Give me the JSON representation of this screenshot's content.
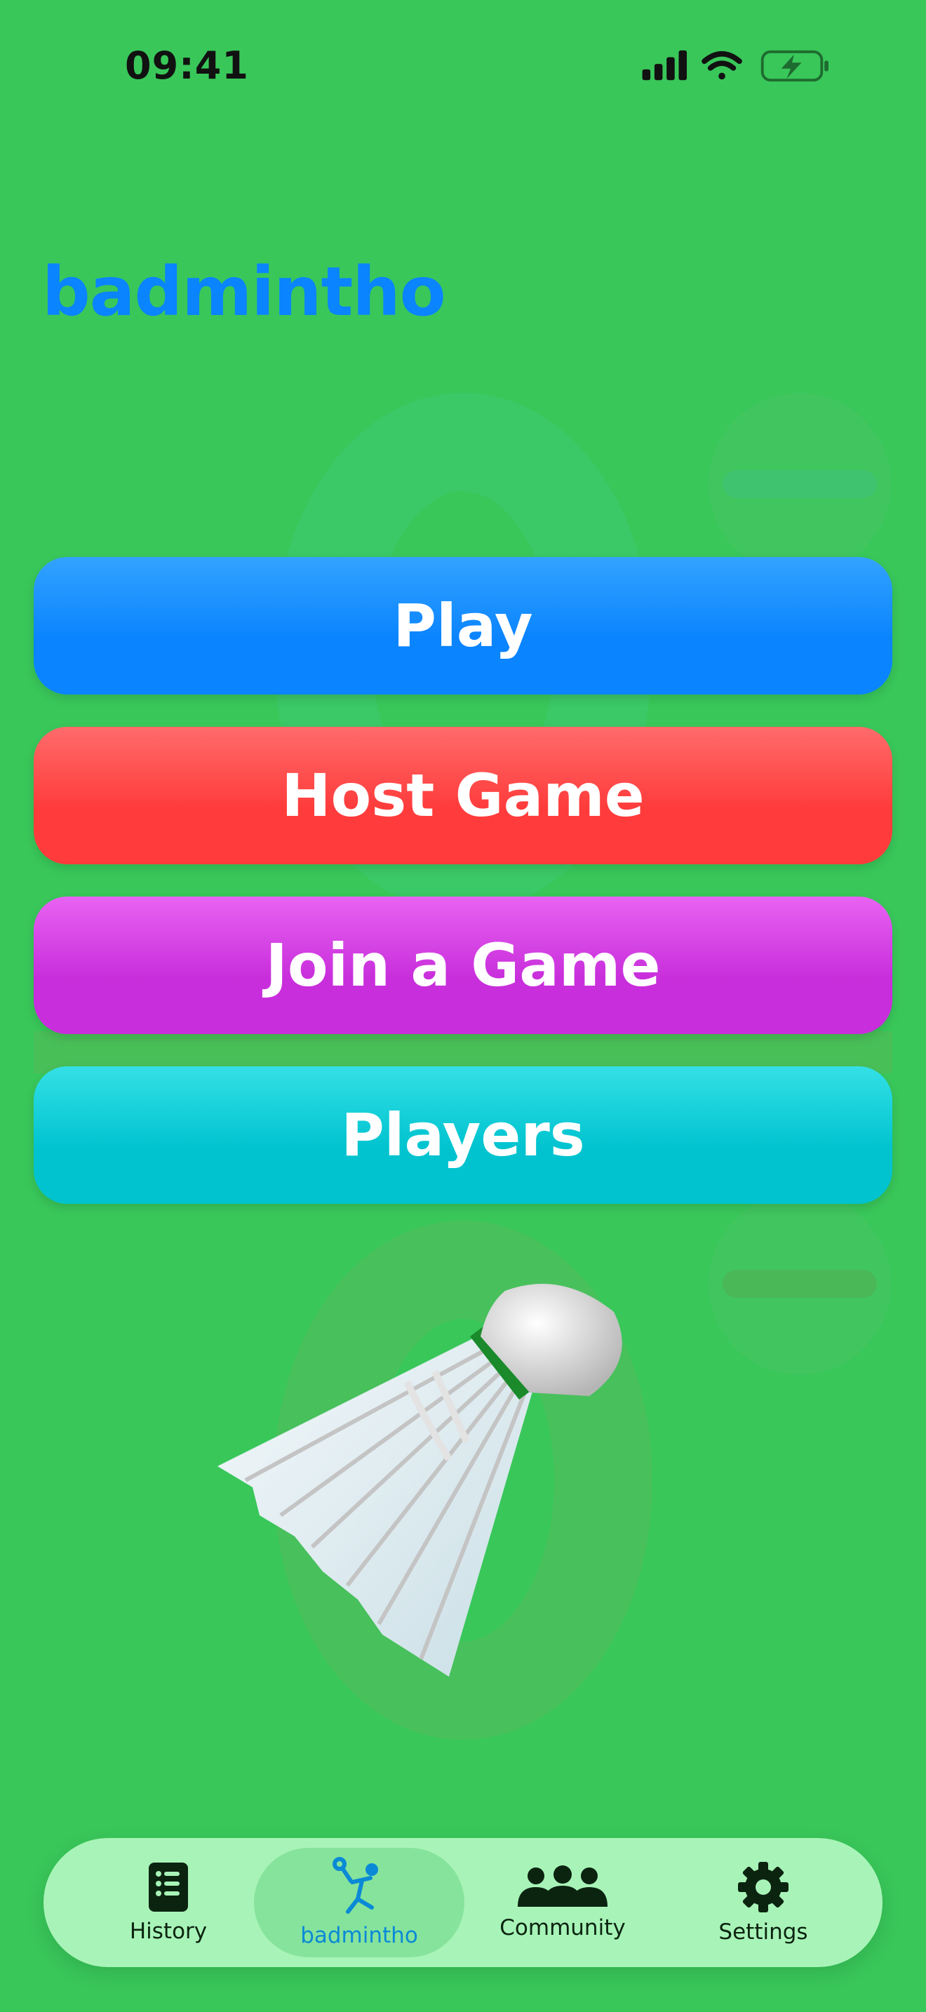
{
  "status": {
    "time": "09:41"
  },
  "app": {
    "title": "badmintho"
  },
  "menu": {
    "play": "Play",
    "host": "Host Game",
    "join": "Join a Game",
    "players": "Players"
  },
  "tabs": [
    {
      "label": "History",
      "icon": "history-icon"
    },
    {
      "label": "badmintho",
      "icon": "badminton-player-icon",
      "active": true
    },
    {
      "label": "Community",
      "icon": "community-icon"
    },
    {
      "label": "Settings",
      "icon": "gear-icon"
    }
  ],
  "colors": {
    "background": "#39c75a",
    "accent": "#0a84ff",
    "play": "#0a84ff",
    "host": "#ff3b3b",
    "join": "#c82edb",
    "players": "#00c3cf"
  }
}
